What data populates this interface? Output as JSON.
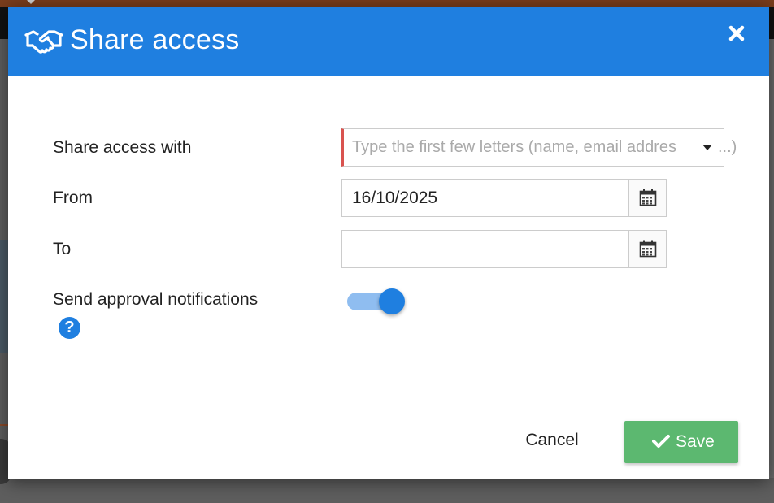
{
  "dialog": {
    "title": "Share access",
    "header_icon": "handshake-icon",
    "close_icon": "close-icon",
    "colors": {
      "header": "#1f7fe0",
      "save": "#5cb870",
      "required_marker": "#d9534f"
    }
  },
  "form": {
    "share_with": {
      "label": "Share access with",
      "placeholder": "Type the first few letters (name, email address...)",
      "placeholder_head": "Type the first few letters (name, email addres",
      "placeholder_tail": "...)",
      "dropdown_icon": "caret-down-icon"
    },
    "from": {
      "label": "From",
      "value": "16/10/2025",
      "icon": "calendar-icon"
    },
    "to": {
      "label": "To",
      "value": "",
      "icon": "calendar-icon"
    },
    "notifications": {
      "label": "Send approval notifications",
      "enabled": true,
      "help_icon": "question-circle-icon",
      "help_glyph": "?"
    }
  },
  "footer": {
    "cancel_label": "Cancel",
    "save_label": "Save",
    "save_icon": "check-icon"
  }
}
